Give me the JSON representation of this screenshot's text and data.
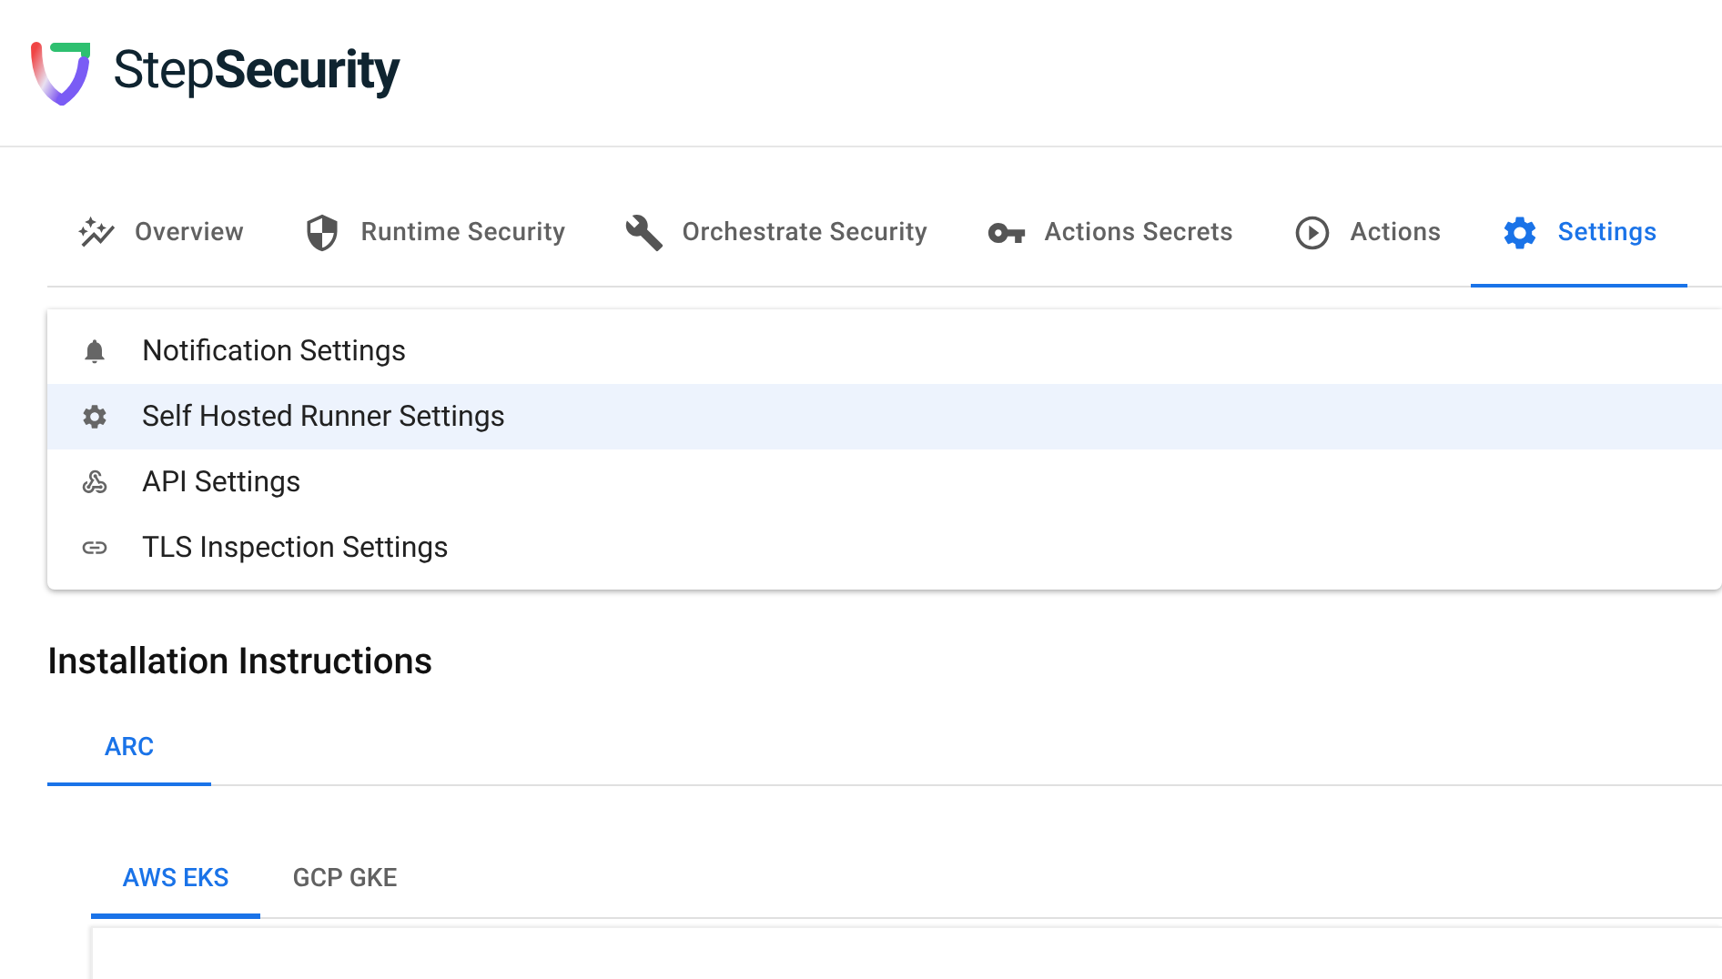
{
  "brand": {
    "name": "Step**Security**"
  },
  "nav_tabs": [
    {
      "kind": "overview",
      "label": "Overview",
      "selected": false
    },
    {
      "kind": "runtime",
      "label": "Runtime Security",
      "selected": false
    },
    {
      "kind": "orchestrate",
      "label": "Orchestrate Security",
      "selected": false
    },
    {
      "kind": "secrets",
      "label": "Actions Secrets",
      "selected": false
    },
    {
      "kind": "actions",
      "label": "Actions",
      "selected": false
    },
    {
      "kind": "settings",
      "label": "Settings",
      "selected": true
    }
  ],
  "settings_menu": [
    {
      "kind": "notification",
      "label": "Notification Settings",
      "selected": false
    },
    {
      "kind": "runner",
      "label": "Self Hosted Runner Settings",
      "selected": true
    },
    {
      "kind": "api",
      "label": "API Settings",
      "selected": false
    },
    {
      "kind": "tls",
      "label": "TLS Inspection Settings",
      "selected": false
    }
  ],
  "section_title": "Installation Instructions",
  "install_tabs": [
    {
      "label": "ARC",
      "selected": true
    }
  ],
  "platform_tabs": [
    {
      "label": "AWS EKS",
      "selected": true
    },
    {
      "label": "GCP GKE",
      "selected": false
    }
  ]
}
